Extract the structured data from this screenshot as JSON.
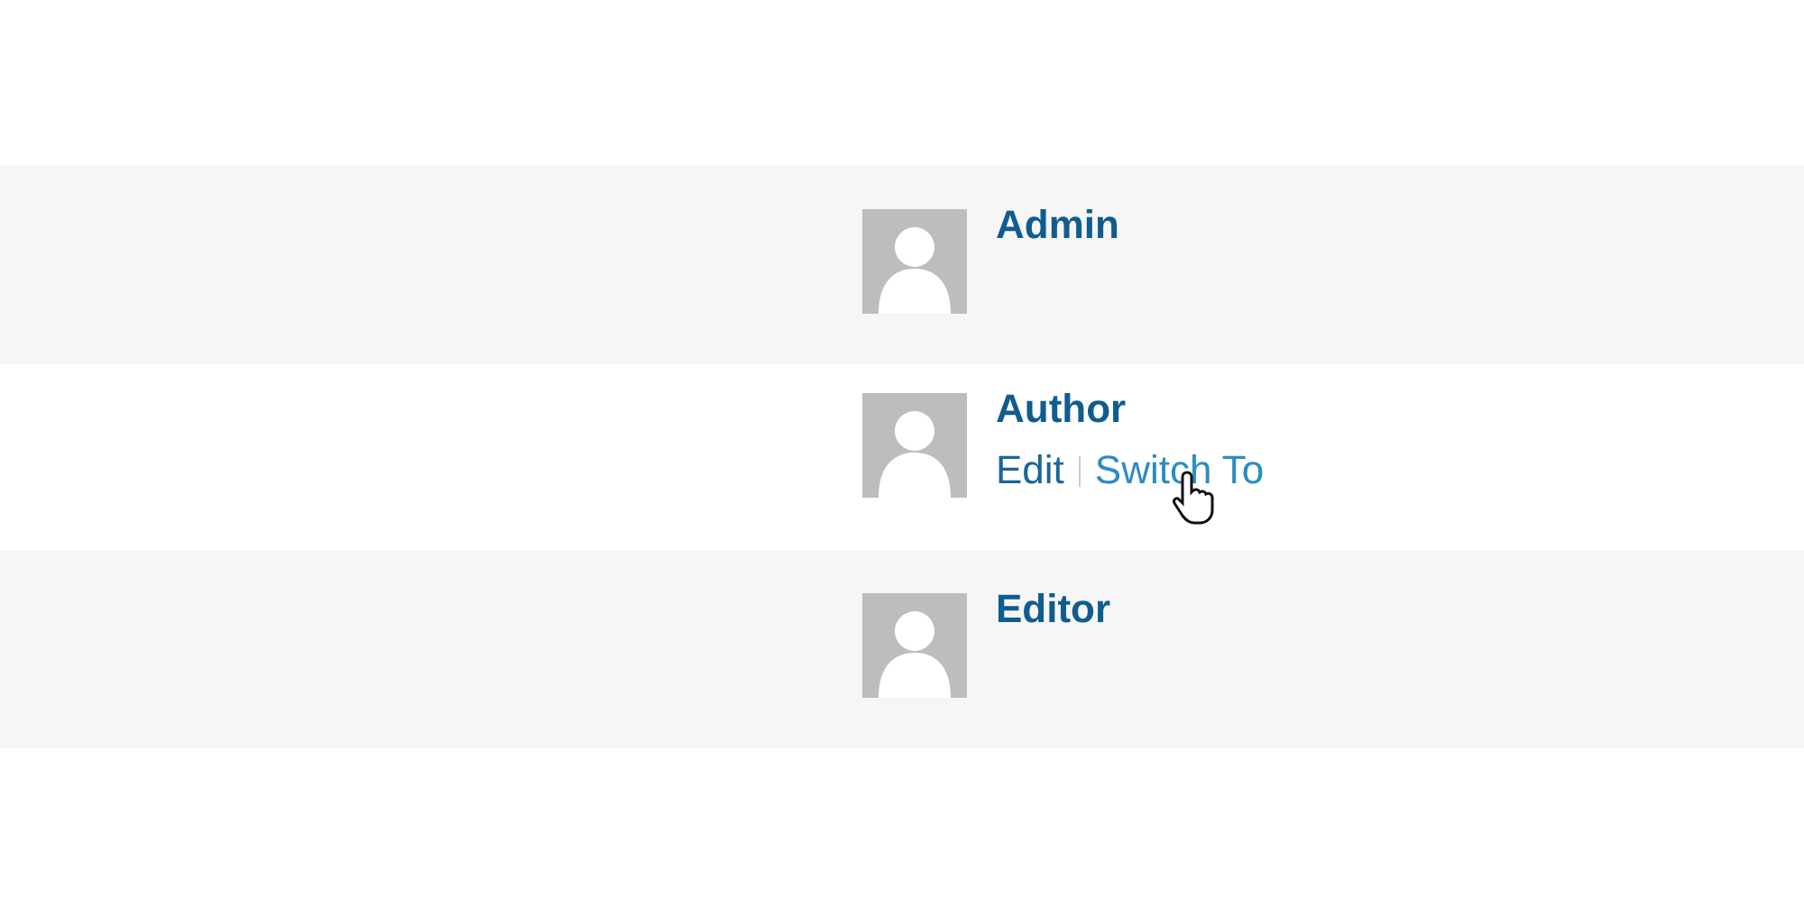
{
  "users": [
    {
      "name": "Admin"
    },
    {
      "name": "Author",
      "actions": [
        {
          "label": "Edit",
          "hovered": false
        },
        {
          "label": "Switch To",
          "hovered": true
        }
      ]
    },
    {
      "name": "Editor"
    }
  ]
}
